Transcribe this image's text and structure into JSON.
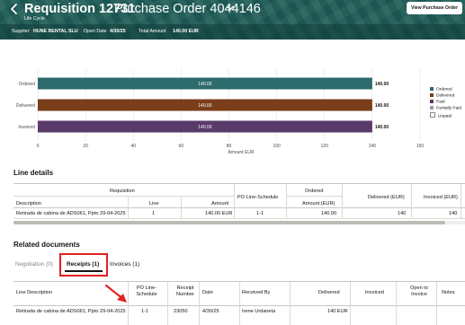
{
  "header": {
    "requisition_title": "Requisition 12731",
    "po_title": "Purchase Order 4044146",
    "subtitle": "Life Cycle",
    "view_po_button": "View Purchase Order",
    "supplier_label": "Supplier",
    "supplier_value": "HUNE RENTAL SLU",
    "open_date_label": "Open Date",
    "open_date_value": "4/30/25",
    "total_amount_label": "Total Amount",
    "total_amount_value": "140.00 EUR",
    "icons": {
      "back": "chevron-left-icon",
      "po_menu": "chevron-down-icon"
    }
  },
  "chart_data": {
    "type": "bar",
    "orientation": "horizontal",
    "categories": [
      "Ordered",
      "Delivered",
      "Invoiced"
    ],
    "values": [
      140,
      140,
      140
    ],
    "bar_labels": [
      "140.00",
      "140.00",
      "140.00"
    ],
    "end_labels": [
      "140.00",
      "140.00",
      "140.00"
    ],
    "bar_colors": [
      "#2d6b6c",
      "#7a3e1a",
      "#5a3a6b"
    ],
    "xlabel": "Amount EUR",
    "xlim": [
      0,
      160
    ],
    "xticks": [
      0,
      20,
      40,
      60,
      80,
      100,
      120,
      140,
      160
    ],
    "grid": true,
    "legend": {
      "position": "right",
      "items": [
        {
          "name": "Ordered",
          "color": "#2d6b6c"
        },
        {
          "name": "Delivered",
          "color": "#7a3e1a"
        },
        {
          "name": "Paid",
          "color": "#5a3a6b"
        },
        {
          "name": "Partially Paid",
          "color": "#a88bb5"
        },
        {
          "name": "Unpaid",
          "color": "#ffffff"
        }
      ]
    }
  },
  "line_details": {
    "title": "Line details",
    "group_headers": {
      "requisition": "Requisition",
      "ordered": "Ordered"
    },
    "columns": {
      "description": "Description",
      "line": "Line",
      "amount": "Amount",
      "po_line_schedule": "PO Line-Schedule",
      "amount_eur": "Amount (EUR)",
      "delivered_eur": "Delivered (EUR)",
      "invoiced_eur": "Invoiced (EUR)"
    },
    "rows": [
      {
        "description": "Retirada de cabina de ADS061, Ppto 29-04-2025",
        "line": "1",
        "amount": "140.00 EUR",
        "po_line_schedule": "1-1",
        "amount_eur": "140.00",
        "delivered_eur": "140",
        "invoiced_eur": "140"
      }
    ]
  },
  "related_documents": {
    "title": "Related documents",
    "tabs": [
      {
        "label": "Negotiation (0)",
        "selected": false
      },
      {
        "label": "Receipts (1)",
        "selected": true
      },
      {
        "label": "Invoices (1)",
        "selected": false
      }
    ],
    "columns": {
      "line_description": "Line Description",
      "po_line_schedule": "PO Line-Schedule",
      "receipt_number": "Receipt Number",
      "date": "Date",
      "received_by": "Received By",
      "delivered": "Delivered",
      "invoiced": "Invoiced",
      "open_to_invoice": "Open to Invoice",
      "notes": "Notes"
    },
    "rows": [
      {
        "line_description": "Retirada de cabina de ADS061, Ppto 29-04-2025",
        "po_line_schedule": "1-1",
        "receipt_number": "23050",
        "date": "4/30/25",
        "received_by": "Irene Urdaneta",
        "delivered": "140 EUR",
        "invoiced": "",
        "open_to_invoice": "",
        "notes": ""
      }
    ]
  },
  "annotation_colors": {
    "highlight": "#e32020"
  }
}
